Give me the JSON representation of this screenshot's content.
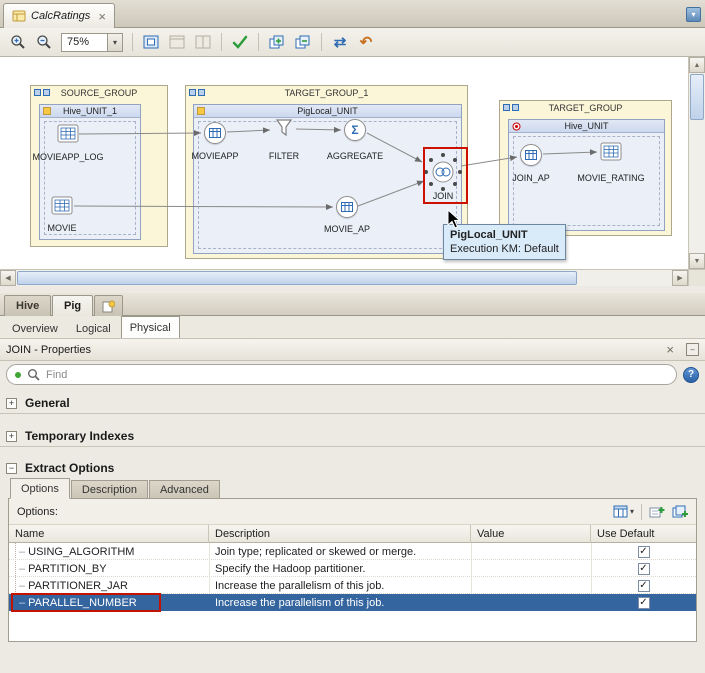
{
  "window": {
    "tab_title": "CalcRatings"
  },
  "toolbar": {
    "zoom_value": "75%"
  },
  "canvas": {
    "groups": {
      "source": {
        "title": "SOURCE_GROUP",
        "unit": "Hive_UNIT_1"
      },
      "target1": {
        "title": "TARGET_GROUP_1",
        "unit": "PigLocal_UNIT"
      },
      "target": {
        "title": "TARGET_GROUP",
        "unit": "Hive_UNIT"
      }
    },
    "nodes": {
      "movieapp_log": "MOVIEAPP_LOG",
      "movie": "MOVIE",
      "movieapp": "MOVIEAPP",
      "filter": "FILTER",
      "aggregate": "AGGREGATE",
      "movie_ap": "MOVIE_AP",
      "join": "JOIN",
      "join_ap": "JOIN_AP",
      "movie_rating": "MOVIE_RATING"
    },
    "tooltip": {
      "title": "PigLocal_UNIT",
      "detail": "Execution KM: Default"
    }
  },
  "tech_tabs": {
    "hive": "Hive",
    "pig": "Pig"
  },
  "view_tabs": {
    "overview": "Overview",
    "logical": "Logical",
    "physical": "Physical"
  },
  "props": {
    "title": "JOIN - Properties",
    "find_placeholder": "Find",
    "sections": {
      "general": "General",
      "temp_indexes": "Temporary Indexes",
      "extract_options": "Extract Options"
    },
    "tabs": {
      "options": "Options",
      "description": "Description",
      "advanced": "Advanced"
    },
    "options_label": "Options:",
    "table": {
      "columns": {
        "name": "Name",
        "description": "Description",
        "value": "Value",
        "use_default": "Use Default"
      },
      "rows": [
        {
          "name": "USING_ALGORITHM",
          "description": "Join type; replicated or skewed or merge.",
          "value": "",
          "use_default": true
        },
        {
          "name": "PARTITION_BY",
          "description": "Specify the Hadoop partitioner.",
          "value": "",
          "use_default": true
        },
        {
          "name": "PARTITIONER_JAR",
          "description": "Increase the parallelism of this job.",
          "value": "",
          "use_default": true
        },
        {
          "name": "PARALLEL_NUMBER",
          "description": "Increase the parallelism of this job.",
          "value": "",
          "use_default": true
        }
      ],
      "selected_row": "PARALLEL_NUMBER"
    }
  },
  "icons": {
    "close": "×",
    "dropdown": "▾",
    "help": "?",
    "expand": "+",
    "collapse": "−",
    "sync": "⇄",
    "undo": "↶",
    "sigma": "Σ",
    "tree_dash": "–",
    "minimize": "–",
    "scroll_up": "▲",
    "scroll_down": "▼",
    "scroll_left": "◀",
    "scroll_right": "▶"
  },
  "colors": {
    "accent_blue": "#2F6CB3",
    "selection_blue": "#35659E",
    "annotation_red": "#CC1100",
    "check_green": "#2E9E3C"
  }
}
